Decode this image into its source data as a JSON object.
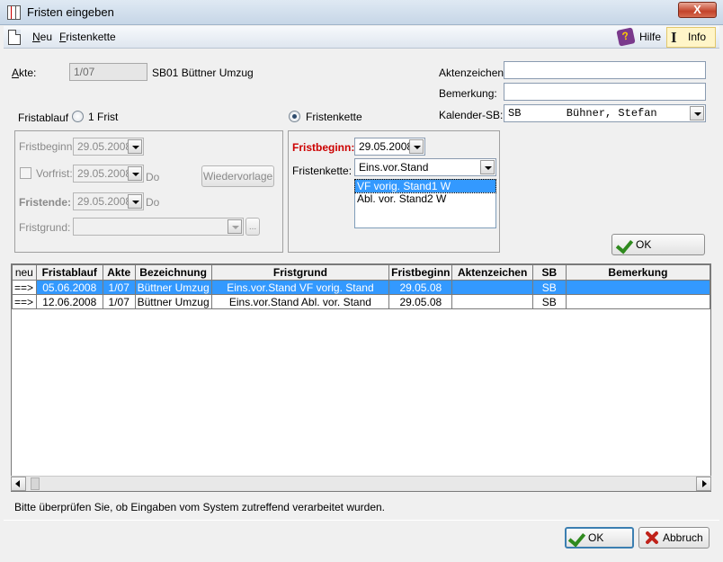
{
  "window": {
    "title": "Fristen eingeben",
    "close_label": "X"
  },
  "menu": {
    "neu": "Neu",
    "neu_key": "N",
    "neu_rest": "eu",
    "fristenkette": "Fristenkette",
    "fristenkette_key": "F",
    "fristenkette_rest": "ristenkette",
    "hilfe": "Hilfe",
    "info": "Info"
  },
  "akte": {
    "label_key": "A",
    "label_rest": "kte:",
    "number": "1/07",
    "description": "SB01 Büttner Umzug"
  },
  "right_fields": {
    "aktenzeichen_label": "Aktenzeichen:",
    "aktenzeichen_value": "",
    "bemerkung_label": "Bemerkung:",
    "bemerkung_value": "",
    "kalender_label": "Kalender-SB:",
    "kalender_value": "SB       Bühner, Stefan"
  },
  "fristablauf": {
    "label": "Fristablauf",
    "option_1frist": "1 Frist",
    "option_fristenkette": "Fristenkette",
    "selected": "Fristenkette"
  },
  "single_frist": {
    "fristbeginn_label": "Fristbeginn:",
    "fristbeginn_value": "29.05.2008",
    "vorfrist_label": "Vorfrist:",
    "vorfrist_value": "29.05.2008",
    "vorfrist_day": "Do",
    "wiedervorlage_label": "Wiedervorlage",
    "fristende_label": "Fristende:",
    "fristende_value": "29.05.2008",
    "fristende_day": "Do",
    "fristgrund_label": "Fristgrund:",
    "fristgrund_value": "",
    "ellipsis": "..."
  },
  "kette": {
    "fristbeginn_label": "Fristbeginn:",
    "fristbeginn_value": "29.05.2008",
    "fristenkette_label": "Fristenkette:",
    "fristenkette_value": "Eins.vor.Stand",
    "items": [
      "VF vorig. Stand1  W",
      "Abl. vor. Stand2  W"
    ],
    "selected_index": 0
  },
  "ok_label": "OK",
  "grid": {
    "columns": [
      "neu",
      "Fristablauf",
      "Akte",
      "Bezeichnung",
      "Fristgrund",
      "Fristbeginn",
      "Aktenzeichen",
      "SB",
      "Bemerkung"
    ],
    "rows": [
      {
        "neu": "==>",
        "fristablauf": "05.06.2008",
        "akte": "1/07",
        "bezeichnung": "Büttner Umzug",
        "fristgrund": "Eins.vor.Stand VF vorig. Stand",
        "fristbeginn": "29.05.08",
        "aktenzeichen": "",
        "sb": "SB",
        "bemerkung": "",
        "selected": true
      },
      {
        "neu": "==>",
        "fristablauf": "12.06.2008",
        "akte": "1/07",
        "bezeichnung": "Büttner Umzug",
        "fristgrund": "Eins.vor.Stand Abl. vor. Stand",
        "fristbeginn": "29.05.08",
        "aktenzeichen": "",
        "sb": "SB",
        "bemerkung": "",
        "selected": false
      }
    ]
  },
  "status": {
    "message": "Bitte überprüfen Sie, ob Eingaben vom System zutreffend verarbeitet wurden."
  },
  "footer": {
    "ok_label": "OK",
    "abbruch_label": "Abbruch"
  },
  "colors": {
    "selection": "#3399ff",
    "required_label": "#cc0000",
    "check": "#2f8a1e",
    "cancel": "#c0221a"
  }
}
